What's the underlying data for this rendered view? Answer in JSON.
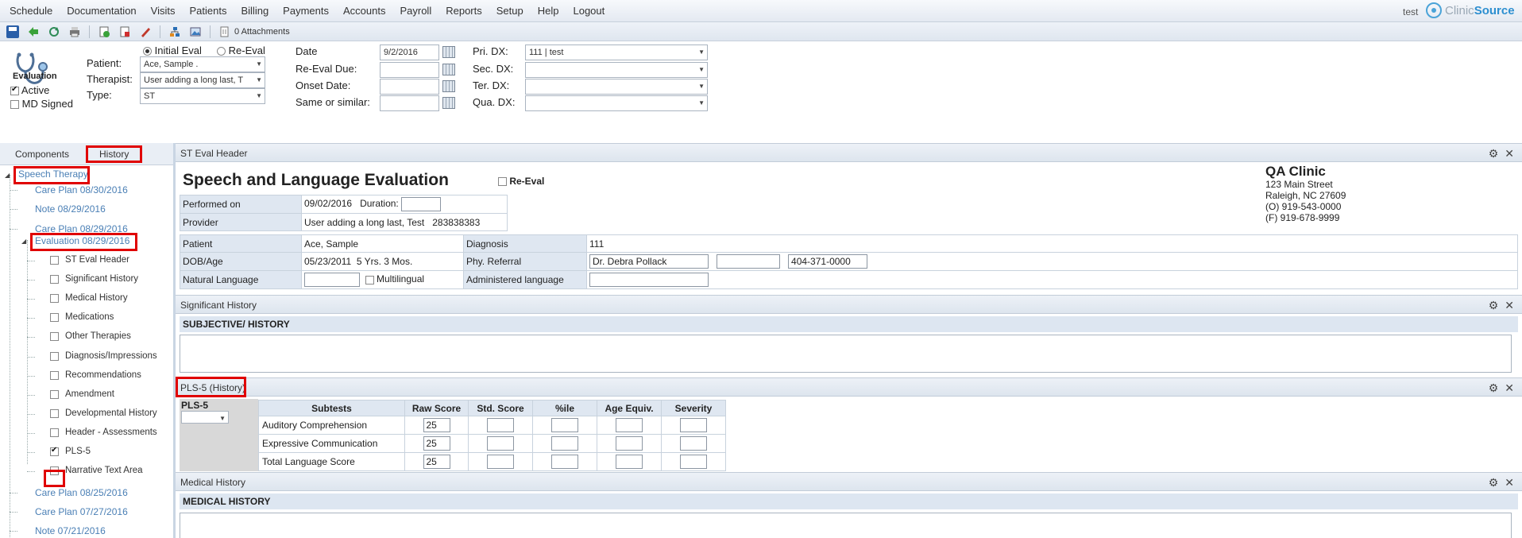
{
  "menu": [
    "Schedule",
    "Documentation",
    "Visits",
    "Patients",
    "Billing",
    "Payments",
    "Accounts",
    "Payroll",
    "Reports",
    "Setup",
    "Help",
    "Logout"
  ],
  "user": "test",
  "logo": {
    "prefix": "Clinic",
    "suffix": "Source"
  },
  "toolbar": {
    "attachments": "0 Attachments"
  },
  "header": {
    "eval_label": "Evaluation",
    "active_label": "Active",
    "md_signed_label": "MD Signed",
    "initial_eval_label": "Initial Eval",
    "re_eval_label": "Re-Eval",
    "patient_label": "Patient:",
    "patient_value": "Ace, Sample  .",
    "therapist_label": "Therapist:",
    "therapist_value": "User adding a long last, T",
    "type_label": "Type:",
    "type_value": "ST",
    "date_label": "Date",
    "date_value": "9/2/2016",
    "reeval_due_label": "Re-Eval Due:",
    "onset_label": "Onset Date:",
    "same_label": "Same or similar:",
    "pri_dx_label": "Pri. DX:",
    "pri_dx_value": "111 | test",
    "sec_dx_label": "Sec. DX:",
    "ter_dx_label": "Ter. DX:",
    "qua_dx_label": "Qua. DX:"
  },
  "left": {
    "tabs": [
      "Components",
      "History"
    ],
    "tree": {
      "root": "Speech Therapy",
      "top_items": [
        "Care Plan 08/30/2016",
        "Note 08/29/2016",
        "Care Plan 08/29/2016"
      ],
      "eval_item": "Evaluation 08/29/2016",
      "eval_children": [
        {
          "label": "ST Eval Header",
          "checked": false
        },
        {
          "label": "Significant History",
          "checked": false
        },
        {
          "label": "Medical History",
          "checked": false
        },
        {
          "label": "Medications",
          "checked": false
        },
        {
          "label": "Other Therapies",
          "checked": false
        },
        {
          "label": "Diagnosis/Impressions",
          "checked": false
        },
        {
          "label": "Recommendations",
          "checked": false
        },
        {
          "label": "Amendment",
          "checked": false
        },
        {
          "label": "Developmental History",
          "checked": false
        },
        {
          "label": "Header - Assessments",
          "checked": false
        },
        {
          "label": "PLS-5",
          "checked": true
        },
        {
          "label": "Narrative Text Area",
          "checked": false
        }
      ],
      "bottom_items": [
        "Care Plan 08/25/2016",
        "Care Plan 07/27/2016",
        "Note 07/21/2016"
      ]
    }
  },
  "eval_header": {
    "section_title": "ST Eval Header",
    "title": "Speech and Language Evaluation",
    "re_eval_label": "Re-Eval",
    "clinic": {
      "name": "QA Clinic",
      "address1": "123 Main Street",
      "address2": "Raleigh, NC 27609",
      "phone": "(O) 919-543-0000",
      "fax": "(F) 919-678-9999"
    },
    "performed_on_label": "Performed on",
    "performed_on_value": "09/02/2016",
    "duration_label": "Duration:",
    "provider_label": "Provider",
    "provider_value": "User adding a long last, Test",
    "provider_id": "283838383",
    "patient_label": "Patient",
    "patient_value": "Ace, Sample",
    "diagnosis_label": "Diagnosis",
    "diagnosis_value": "111",
    "dob_label": "DOB/Age",
    "dob_value": "05/23/2011",
    "age_value": "5 Yrs. 3 Mos.",
    "phy_referral_label": "Phy. Referral",
    "phy_referral_name": "Dr. Debra Pollack",
    "phy_referral_phone": "404-371-0000",
    "natural_language_label": "Natural Language",
    "multilingual_label": "Multilingual",
    "administered_language_label": "Administered language"
  },
  "significant_history": {
    "section_title": "Significant History",
    "bar": "SUBJECTIVE/  HISTORY"
  },
  "pls5": {
    "section_title": "PLS-5 (History)",
    "label": "PLS-5",
    "columns": [
      "Subtests",
      "Raw Score",
      "Std. Score",
      "%ile",
      "Age Equiv.",
      "Severity"
    ],
    "rows": [
      {
        "name": "Auditory Comprehension",
        "raw": "25"
      },
      {
        "name": "Expressive Communication",
        "raw": "25"
      },
      {
        "name": "Total Language Score",
        "raw": "25"
      }
    ]
  },
  "medical_history": {
    "section_title": "Medical History",
    "bar": "MEDICAL HISTORY"
  }
}
